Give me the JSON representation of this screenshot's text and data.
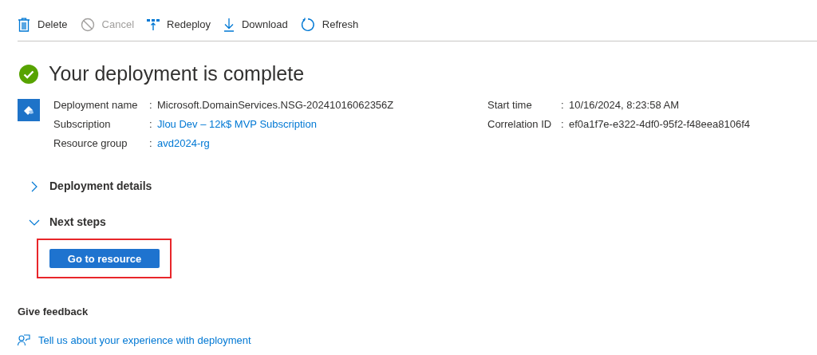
{
  "toolbar": [
    {
      "kind": "delete",
      "label": "Delete",
      "disabled": false
    },
    {
      "kind": "cancel",
      "label": "Cancel",
      "disabled": true
    },
    {
      "kind": "redeploy",
      "label": "Redeploy",
      "disabled": false
    },
    {
      "kind": "download",
      "label": "Download",
      "disabled": false
    },
    {
      "kind": "refresh",
      "label": "Refresh",
      "disabled": false
    }
  ],
  "title": "Your deployment is complete",
  "details_left": [
    {
      "label": "Deployment name",
      "separator": ":",
      "value": "Microsoft.DomainServices.NSG-20241016062356Z",
      "link": false
    },
    {
      "label": "Subscription",
      "separator": ":",
      "value": "Jlou Dev – 12k$ MVP Subscription",
      "link": true
    },
    {
      "label": "Resource group",
      "separator": ":",
      "value": "avd2024-rg",
      "link": true
    }
  ],
  "details_right": [
    {
      "label": "Start time",
      "separator": ":",
      "value": "10/16/2024, 8:23:58 AM",
      "link": false
    },
    {
      "label": "Correlation ID",
      "separator": ":",
      "value": "ef0a1f7e-e322-4df0-95f2-f48eea8106f4",
      "link": false
    }
  ],
  "sections": [
    {
      "label": "Deployment details",
      "expanded": false
    },
    {
      "label": "Next steps",
      "expanded": true
    }
  ],
  "next_step_button": {
    "label": "Go to resource",
    "highlighted": true
  },
  "feedback": {
    "heading": "Give feedback",
    "link": "Tell us about your experience with deployment"
  }
}
